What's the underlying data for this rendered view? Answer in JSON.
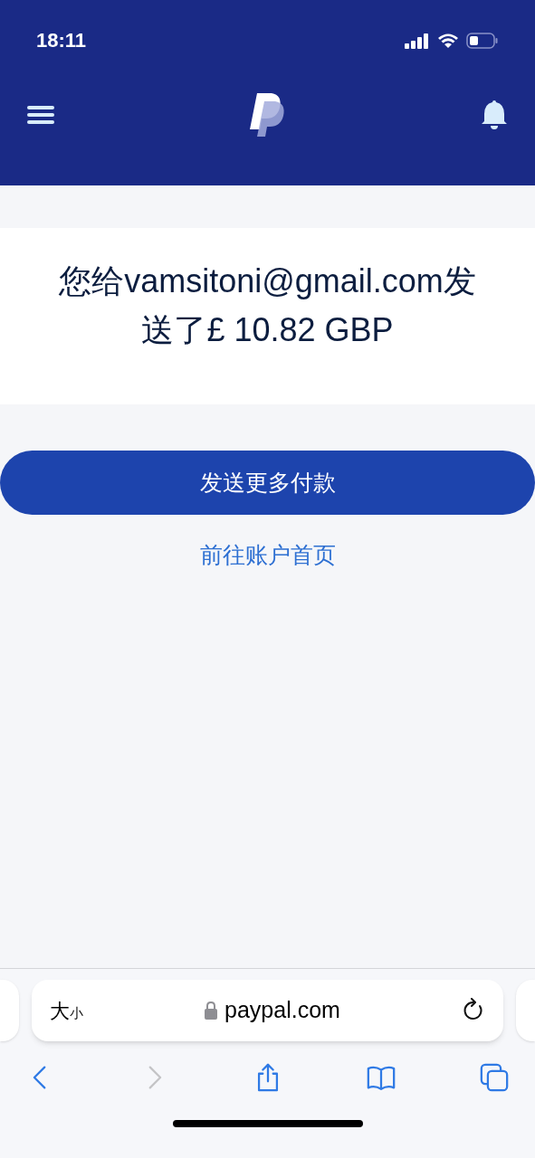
{
  "status_bar": {
    "time": "18:11"
  },
  "message": "您给vamsitoni@gmail.com发送了£ 10.82 GBP",
  "primary_button": "发送更多付款",
  "link": "前往账户首页",
  "address_bar": {
    "text_size_large": "大",
    "text_size_small": "小",
    "url": "paypal.com"
  },
  "toolbar": [
    {
      "kind": "back",
      "disabled": false
    },
    {
      "kind": "forward",
      "disabled": true
    },
    {
      "kind": "share",
      "disabled": false
    },
    {
      "kind": "bookmarks",
      "disabled": false
    },
    {
      "kind": "tabs",
      "disabled": false
    }
  ]
}
